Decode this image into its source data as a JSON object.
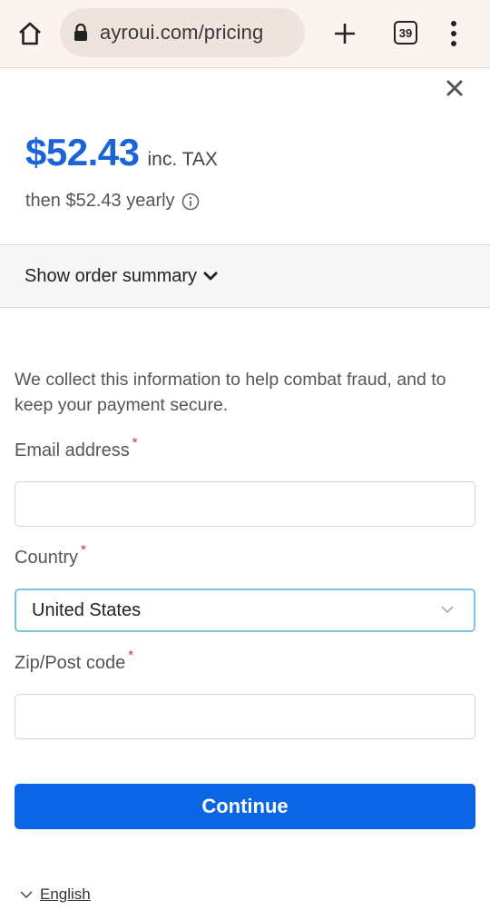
{
  "browser": {
    "url": "ayroui.com/pricing",
    "tab_count": "39"
  },
  "pricing": {
    "price": "$52.43",
    "tax_note": "inc. TAX",
    "recurring": "then $52.43 yearly"
  },
  "summary": {
    "label": "Show order summary"
  },
  "form": {
    "notice": "We collect this information to help combat fraud, and to keep your payment secure.",
    "email_label": "Email address",
    "email_value": "",
    "country_label": "Country",
    "country_value": "United States",
    "zip_label": "Zip/Post code",
    "zip_value": "",
    "required_mark": "*",
    "continue_label": "Continue"
  },
  "footer": {
    "language": "English"
  },
  "colors": {
    "accent": "#1a63d8",
    "button": "#0a66e6",
    "required": "#d0312d",
    "focus_border": "#77c6dd"
  },
  "icons": [
    "home-icon",
    "lock-icon",
    "plus-icon",
    "tabs-count-icon",
    "more-vert-icon",
    "close-icon",
    "info-icon",
    "chevron-down-icon"
  ]
}
